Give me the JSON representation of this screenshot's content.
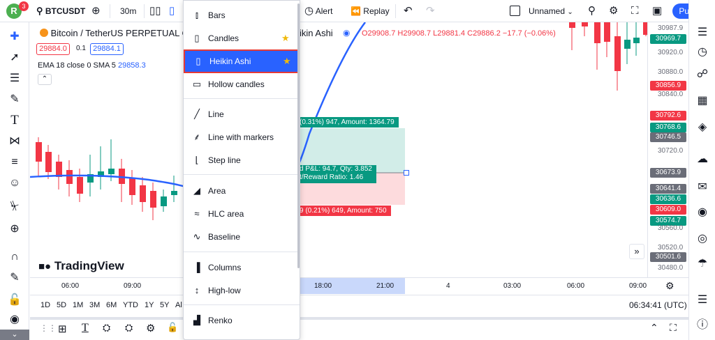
{
  "topbar": {
    "avatar_letter": "R",
    "notification_count": "3",
    "symbol": "BTCUSDT",
    "interval": "30m",
    "alert_label": "Alert",
    "replay_label": "Replay",
    "layout_name": "Unnamed",
    "publish_label": "Publish"
  },
  "legend": {
    "title": "Bitcoin / TetherUS PERPETUAL C",
    "title_tail": "ikin Ashi",
    "ohlc": {
      "o": "O29908.7",
      "h": "H29908.7",
      "l": "L29881.4",
      "c": "C29886.2",
      "chg": "−17.7 (−0.06%)"
    },
    "bid": "29884.0",
    "spread": "0.1",
    "ask": "29884.1",
    "indicator": "EMA 18 close 0 SMA 5",
    "indicator_value": "29858.3"
  },
  "position_tool": {
    "target_label": "(0.31%) 947, Amount: 1364.79",
    "center_line1": "d P&L: 94.7, Qty: 3.852",
    "center_line2": "t/Reward Ratio: 1.46",
    "stop_label": "9 (0.21%) 649, Amount: 750"
  },
  "price_labels": [
    {
      "text": "30987.9",
      "kind": "tick"
    },
    {
      "text": "30969.7",
      "kind": "green"
    },
    {
      "text": "30920.0",
      "kind": "tick"
    },
    {
      "text": "30880.0",
      "kind": "tick"
    },
    {
      "text": "30856.9",
      "kind": "red"
    },
    {
      "text": "30840.0",
      "kind": "tick"
    },
    {
      "text": "30792.6",
      "kind": "red"
    },
    {
      "text": "30768.6",
      "kind": "green"
    },
    {
      "text": "30746.5",
      "kind": "grey"
    },
    {
      "text": "30720.0",
      "kind": "tick"
    },
    {
      "text": "30673.9",
      "kind": "grey"
    },
    {
      "text": "30641.4",
      "kind": "grey"
    },
    {
      "text": "30636.6",
      "kind": "green"
    },
    {
      "text": "30609.0",
      "kind": "red"
    },
    {
      "text": "30574.7",
      "kind": "green"
    },
    {
      "text": "30560.0",
      "kind": "tick"
    },
    {
      "text": "30520.0",
      "kind": "tick"
    },
    {
      "text": "30501.6",
      "kind": "grey"
    },
    {
      "text": "30480.0",
      "kind": "tick"
    }
  ],
  "time_ticks": [
    "06:00",
    "09:00",
    "18:00",
    "21:00",
    "4",
    "03:00",
    "06:00",
    "09:00"
  ],
  "ranges": [
    "1D",
    "5D",
    "1M",
    "3M",
    "6M",
    "YTD",
    "1Y",
    "5Y",
    "Al"
  ],
  "clock": "06:34:41 (UTC)",
  "branding": "TradingView",
  "chart_menu": {
    "items": [
      {
        "label": "Bars",
        "icon": "bars-icon",
        "star": false
      },
      {
        "label": "Candles",
        "icon": "candles-icon",
        "star": true
      },
      {
        "label": "Heikin Ashi",
        "icon": "heikin-ashi-icon",
        "star": true,
        "selected": true
      },
      {
        "label": "Hollow candles",
        "icon": "hollow-candles-icon",
        "star": false
      },
      {
        "label": "Line",
        "icon": "line-icon",
        "star": false
      },
      {
        "label": "Line with markers",
        "icon": "line-markers-icon",
        "star": false
      },
      {
        "label": "Step line",
        "icon": "step-line-icon",
        "star": false
      },
      {
        "label": "Area",
        "icon": "area-icon",
        "star": false
      },
      {
        "label": "HLC area",
        "icon": "hlc-area-icon",
        "star": false
      },
      {
        "label": "Baseline",
        "icon": "baseline-icon",
        "star": false
      },
      {
        "label": "Columns",
        "icon": "columns-icon",
        "star": false
      },
      {
        "label": "High-low",
        "icon": "high-low-icon",
        "star": false
      },
      {
        "label": "Renko",
        "icon": "renko-icon",
        "star": false
      }
    ]
  },
  "colors": {
    "up": "#089981",
    "down": "#f23645",
    "accent": "#2962ff",
    "ema": "#2962ff"
  }
}
